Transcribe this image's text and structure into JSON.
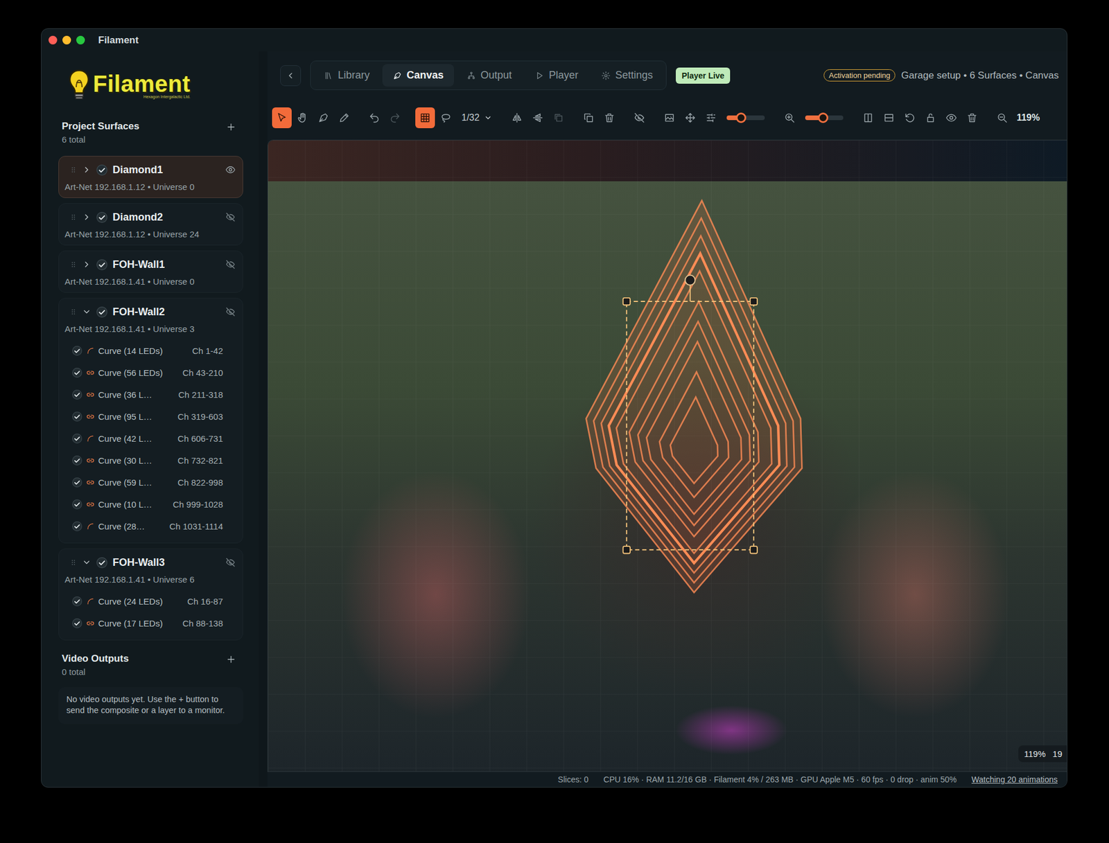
{
  "window": {
    "title": "Filament"
  },
  "logo": {
    "text": "Filament",
    "tagline": "Hexagon Intergalactic Ltd."
  },
  "nav": {
    "tabs": [
      {
        "label": "Library",
        "selected": false
      },
      {
        "label": "Canvas",
        "selected": true
      },
      {
        "label": "Output",
        "selected": false
      },
      {
        "label": "Player",
        "selected": false
      },
      {
        "label": "Settings",
        "selected": false
      }
    ],
    "live_badge": "Player Live",
    "activation": "Activation pending",
    "breadcrumb": "Garage setup • 6 Surfaces • Canvas"
  },
  "toolbar": {
    "tools": [
      {
        "selected": true,
        "disabled": false
      },
      {
        "selected": false,
        "disabled": false
      },
      {
        "selected": false,
        "disabled": false
      },
      {
        "selected": false,
        "disabled": false
      },
      {
        "selected": false,
        "disabled": false
      },
      {
        "selected": false,
        "disabled": true
      },
      {
        "selected": true,
        "disabled": false
      },
      {
        "selected": false,
        "disabled": false
      },
      {
        "selected": false,
        "disabled": false
      },
      {
        "selected": false,
        "disabled": false
      },
      {
        "selected": false,
        "disabled": true
      },
      {
        "selected": false,
        "disabled": false
      },
      {
        "selected": false,
        "disabled": false
      },
      {
        "selected": false,
        "disabled": false
      },
      {
        "selected": false,
        "disabled": false
      },
      {
        "selected": false,
        "disabled": false
      },
      {
        "selected": false,
        "disabled": false
      },
      {
        "selected": false,
        "disabled": false
      },
      {
        "selected": false,
        "disabled": false
      },
      {
        "selected": false,
        "disabled": false
      },
      {
        "selected": false,
        "disabled": false
      },
      {
        "selected": false,
        "disabled": false
      },
      {
        "selected": false,
        "disabled": false
      },
      {
        "selected": false,
        "disabled": false
      },
      {
        "selected": false,
        "disabled": false
      }
    ],
    "page": "1/32",
    "sliders": [
      {
        "level": 0.37
      },
      {
        "level": 0.47
      }
    ],
    "zoom": "119%"
  },
  "sidebar": {
    "surfaces_title": "Project Surfaces",
    "surfaces_count": "6 total",
    "surfaces": [
      {
        "name": "Diamond1",
        "address": "Art-Net 192.168.1.12 • Universe 0",
        "checked": true,
        "expanded": false,
        "visible": true,
        "selected": true,
        "curves": []
      },
      {
        "name": "Diamond2",
        "address": "Art-Net 192.168.1.12 • Universe 24",
        "checked": true,
        "expanded": false,
        "visible": false,
        "selected": false,
        "curves": []
      },
      {
        "name": "FOH-Wall1",
        "address": "Art-Net 192.168.1.41 • Universe 0",
        "checked": true,
        "expanded": false,
        "visible": false,
        "selected": false,
        "curves": []
      },
      {
        "name": "FOH-Wall2",
        "address": "Art-Net 192.168.1.41 • Universe 3",
        "checked": true,
        "expanded": true,
        "visible": false,
        "selected": false,
        "curves": [
          {
            "label": "Curve (14 LEDs)",
            "channels": "Ch 1-42",
            "checked": true,
            "kind": "arc"
          },
          {
            "label": "Curve (56 LEDs)",
            "channels": "Ch 43-210",
            "checked": true,
            "kind": "link"
          },
          {
            "label": "Curve (36 L…",
            "channels": "Ch 211-318",
            "checked": true,
            "kind": "link"
          },
          {
            "label": "Curve (95 L…",
            "channels": "Ch 319-603",
            "checked": true,
            "kind": "link"
          },
          {
            "label": "Curve (42 L…",
            "channels": "Ch 606-731",
            "checked": true,
            "kind": "arc"
          },
          {
            "label": "Curve (30 L…",
            "channels": "Ch 732-821",
            "checked": true,
            "kind": "link"
          },
          {
            "label": "Curve (59 L…",
            "channels": "Ch 822-998",
            "checked": true,
            "kind": "link"
          },
          {
            "label": "Curve (10 L…",
            "channels": "Ch 999-1028",
            "checked": true,
            "kind": "link"
          },
          {
            "label": "Curve (28…",
            "channels": "Ch 1031-1114",
            "checked": true,
            "kind": "arc"
          }
        ]
      },
      {
        "name": "FOH-Wall3",
        "address": "Art-Net 192.168.1.41 • Universe 6",
        "checked": true,
        "expanded": true,
        "visible": false,
        "selected": false,
        "curves": [
          {
            "label": "Curve (24 LEDs)",
            "channels": "Ch 16-87",
            "checked": true,
            "kind": "arc"
          },
          {
            "label": "Curve (17 LEDs)",
            "channels": "Ch 88-138",
            "checked": true,
            "kind": "link"
          }
        ]
      }
    ],
    "outputs_title": "Video Outputs",
    "outputs_count": "0 total",
    "outputs_empty": "No video outputs yet. Use the + button to send the composite or a layer to a monitor."
  },
  "canvas": {
    "zoom_badge": "119%",
    "zoom_badge_extra": "19"
  },
  "status_bar": {
    "slices": "Slices: 0",
    "metrics": "CPU 16% · RAM 11.2/16 GB · Filament 4% / 263 MB · GPU Apple M5 · 60 fps · 0 drop · anim 50%",
    "watching": "Watching 20 animations"
  }
}
